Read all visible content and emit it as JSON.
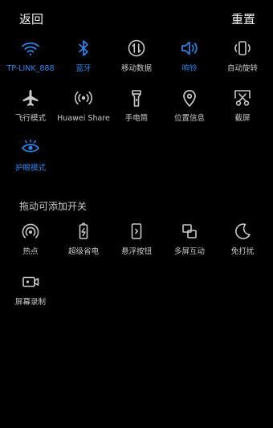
{
  "header": {
    "back_label": "返回",
    "reset_label": "重置"
  },
  "colors": {
    "active": "#2f86e8",
    "inactive": "#c8c8c8",
    "background": "#000000"
  },
  "active_tiles": [
    {
      "label": "TP-LINK_888",
      "icon": "wifi-icon",
      "on": true
    },
    {
      "label": "蓝牙",
      "icon": "bluetooth-icon",
      "on": true
    },
    {
      "label": "移动数据",
      "icon": "mobile-data-icon",
      "on": false
    },
    {
      "label": "响铃",
      "icon": "ring-icon",
      "on": true
    },
    {
      "label": "自动旋转",
      "icon": "auto-rotate-icon",
      "on": false
    },
    {
      "label": "飞行模式",
      "icon": "airplane-icon",
      "on": false
    },
    {
      "label": "Huawei Share",
      "icon": "huawei-share-icon",
      "on": false
    },
    {
      "label": "手电筒",
      "icon": "flashlight-icon",
      "on": false
    },
    {
      "label": "位置信息",
      "icon": "location-icon",
      "on": false
    },
    {
      "label": "截屏",
      "icon": "screenshot-icon",
      "on": false
    },
    {
      "label": "护眼模式",
      "icon": "eye-comfort-icon",
      "on": true
    }
  ],
  "available_section": {
    "title": "拖动可添加开关",
    "tiles": [
      {
        "label": "热点",
        "icon": "hotspot-icon"
      },
      {
        "label": "超级省电",
        "icon": "battery-saver-icon"
      },
      {
        "label": "悬浮按钮",
        "icon": "floating-button-icon"
      },
      {
        "label": "多屏互动",
        "icon": "multi-screen-icon"
      },
      {
        "label": "免打扰",
        "icon": "do-not-disturb-icon"
      },
      {
        "label": "屏幕录制",
        "icon": "screen-record-icon"
      }
    ]
  }
}
